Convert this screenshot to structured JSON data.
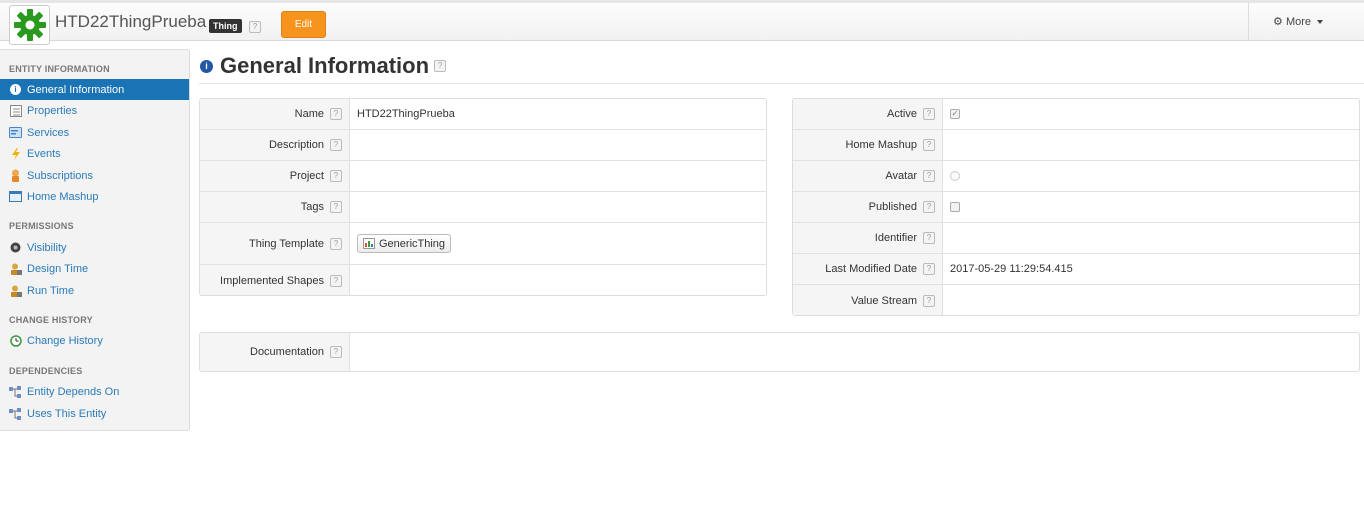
{
  "header": {
    "entity_name": "HTD22ThingPrueba",
    "type_badge": "Thing",
    "help_glyph": "?",
    "edit_label": "Edit",
    "more_label": "More",
    "gear_icon": "gear-icon",
    "logo_color": "#2a9a1e",
    "edit_color": "#f7941d"
  },
  "sidebar": {
    "sections": [
      {
        "title": "ENTITY INFORMATION",
        "items": [
          {
            "label": "General Information",
            "icon": "info-icon",
            "active": true
          },
          {
            "label": "Properties",
            "icon": "properties-icon"
          },
          {
            "label": "Services",
            "icon": "services-icon"
          },
          {
            "label": "Events",
            "icon": "lightning-icon"
          },
          {
            "label": "Subscriptions",
            "icon": "subscriptions-icon"
          },
          {
            "label": "Home Mashup",
            "icon": "mashup-icon"
          }
        ]
      },
      {
        "title": "PERMISSIONS",
        "items": [
          {
            "label": "Visibility",
            "icon": "eye-icon"
          },
          {
            "label": "Design Time",
            "icon": "user-lock-icon"
          },
          {
            "label": "Run Time",
            "icon": "user-lock-icon"
          }
        ]
      },
      {
        "title": "CHANGE HISTORY",
        "items": [
          {
            "label": "Change History",
            "icon": "history-icon"
          }
        ]
      },
      {
        "title": "DEPENDENCIES",
        "items": [
          {
            "label": "Entity Depends On",
            "icon": "dependency-icon"
          },
          {
            "label": "Uses This Entity",
            "icon": "dependency-icon"
          }
        ]
      }
    ],
    "active_color": "#1a73b4",
    "link_color": "#2b7bb9"
  },
  "main": {
    "title": "General Information",
    "left_panel": [
      {
        "label": "Name",
        "value": "HTD22ThingPrueba"
      },
      {
        "label": "Description",
        "value": ""
      },
      {
        "label": "Project",
        "value": ""
      },
      {
        "label": "Tags",
        "value": ""
      },
      {
        "label": "Thing Template",
        "value": "GenericThing"
      },
      {
        "label": "Implemented Shapes",
        "value": ""
      }
    ],
    "right_panel": [
      {
        "label": "Active",
        "value": "",
        "checked": true
      },
      {
        "label": "Home Mashup",
        "value": ""
      },
      {
        "label": "Avatar",
        "value": ""
      },
      {
        "label": "Published",
        "value": "",
        "checked": false
      },
      {
        "label": "Identifier",
        "value": ""
      },
      {
        "label": "Last Modified Date",
        "value": "2017-05-29 11:29:54.415"
      },
      {
        "label": "Value Stream",
        "value": ""
      }
    ],
    "documentation": {
      "label": "Documentation",
      "value": ""
    }
  }
}
